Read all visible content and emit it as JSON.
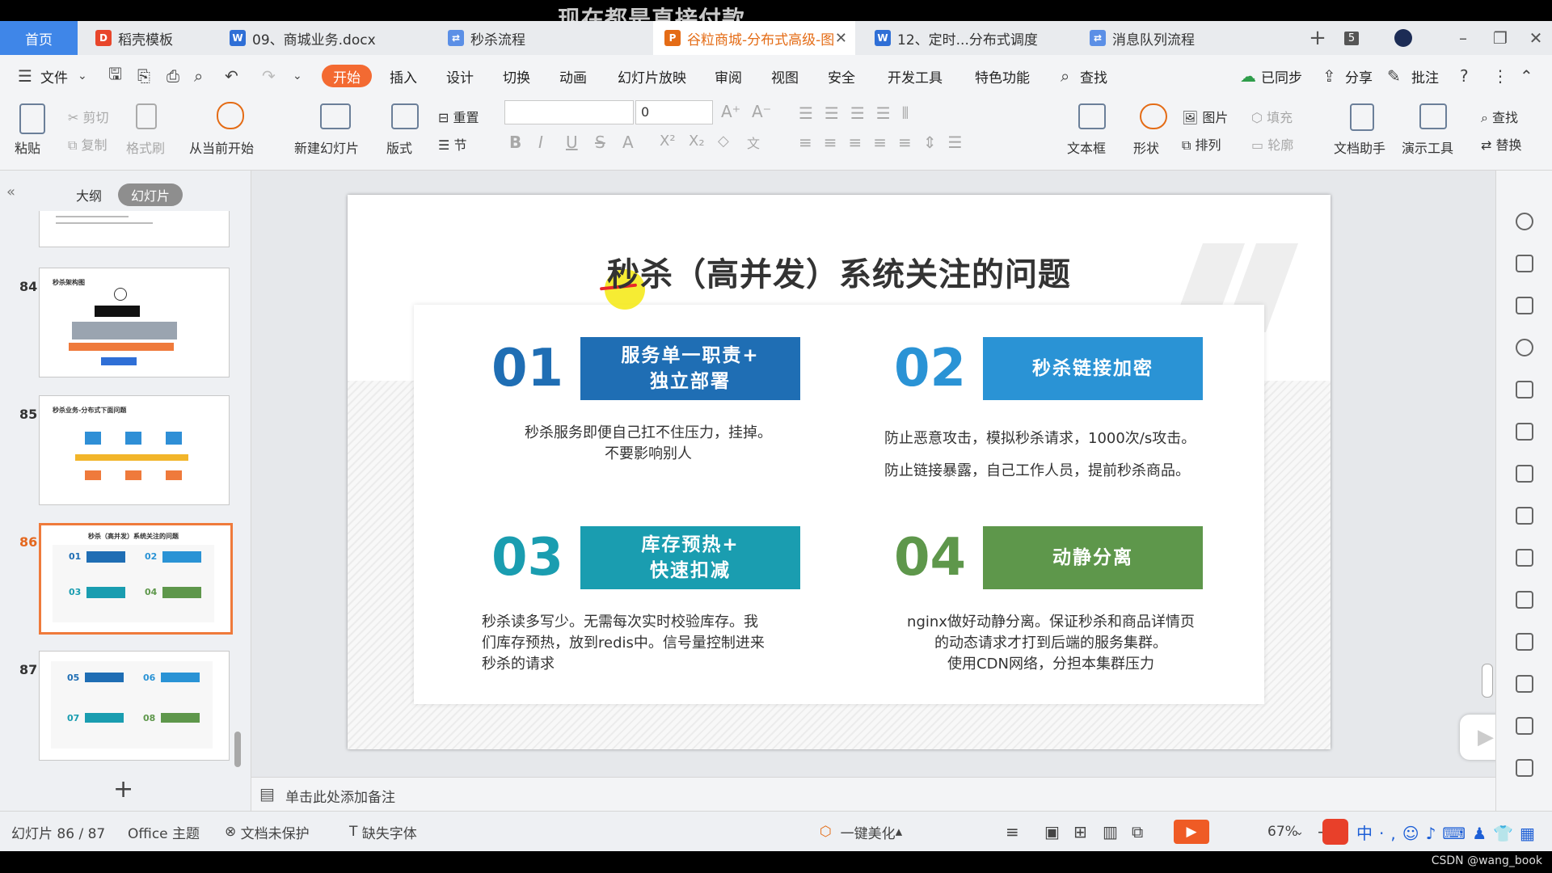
{
  "overlay_subtitle": "现在都是直接付款",
  "tabs": [
    {
      "label": "首页"
    },
    {
      "label": "稻壳模板"
    },
    {
      "label": "09、商城业务.docx"
    },
    {
      "label": "秒杀流程"
    },
    {
      "label": "谷粒商城-分布式高级-图"
    },
    {
      "label": "12、定时...分布式调度"
    },
    {
      "label": "消息队列流程"
    }
  ],
  "tab_count": "5",
  "menu": {
    "file": "文件",
    "items": [
      "开始",
      "插入",
      "设计",
      "切换",
      "动画",
      "幻灯片放映",
      "审阅",
      "视图",
      "安全",
      "开发工具",
      "特色功能"
    ],
    "search": "查找",
    "sync": "已同步",
    "share": "分享",
    "annotate": "批注"
  },
  "ribbon": {
    "paste": "粘贴",
    "cut": "剪切",
    "copy": "复制",
    "format_painter": "格式刷",
    "from_current": "从当前开始",
    "new_slide": "新建幻灯片",
    "layout": "版式",
    "reset": "重置",
    "section": "节",
    "font_size": "0",
    "text_box": "文本框",
    "shape": "形状",
    "picture": "图片",
    "arrange": "排列",
    "fill": "填充",
    "outline": "轮廓",
    "doc_assistant": "文档助手",
    "presentation_tools": "演示工具",
    "find": "查找",
    "replace": "替换"
  },
  "left_panel": {
    "outline_tab": "大纲",
    "slides_tab": "幻灯片",
    "slide_numbers": [
      "84",
      "85",
      "86",
      "87"
    ],
    "thumb84_title": "秒杀架构图",
    "thumb85_title": "秒杀业务-分布式下面问题",
    "thumb86_title": "秒杀（高并发）系统关注的问题",
    "thumb86_labels": [
      "01",
      "02",
      "03",
      "04"
    ],
    "thumb87_labels": [
      "05",
      "06",
      "07",
      "08"
    ]
  },
  "slide": {
    "title": "秒杀（高并发）系统关注的问题",
    "items": [
      {
        "num": "01",
        "head1": "服务单一职责+",
        "head2": "独立部署",
        "desc": [
          "秒杀服务即便自己扛不住压力，挂掉。",
          "不要影响别人"
        ],
        "color": "#1f6eb4",
        "num_color": "#1f6eb4"
      },
      {
        "num": "02",
        "head1": "秒杀链接加密",
        "head2": "",
        "desc": [
          "防止恶意攻击，模拟秒杀请求，1000次/s攻击。",
          "防止链接暴露，自己工作人员，提前秒杀商品。"
        ],
        "color": "#2a93d5",
        "num_color": "#2a93d5"
      },
      {
        "num": "03",
        "head1": "库存预热+",
        "head2": "快速扣减",
        "desc": [
          "秒杀读多写少。无需每次实时校验库存。我",
          "们库存预热，放到redis中。信号量控制进来",
          "秒杀的请求"
        ],
        "color": "#1a9db0",
        "num_color": "#1a9db0"
      },
      {
        "num": "04",
        "head1": "动静分离",
        "head2": "",
        "desc": [
          "nginx做好动静分离。保证秒杀和商品详情页",
          "的动态请求才打到后端的服务集群。",
          "使用CDN网络，分担本集群压力"
        ],
        "color": "#5e974b",
        "num_color": "#5e974b"
      }
    ]
  },
  "notes_placeholder": "单击此处添加备注",
  "status": {
    "slide_info": "幻灯片 86 / 87",
    "theme": "Office 主题",
    "protect": "文档未保护",
    "missing_font": "缺失字体",
    "beautify": "一键美化",
    "zoom": "67%"
  },
  "watermark": "CSDN @wang_book",
  "colors": {
    "accent": "#f36a32",
    "home_tab": "#3f86e8"
  }
}
